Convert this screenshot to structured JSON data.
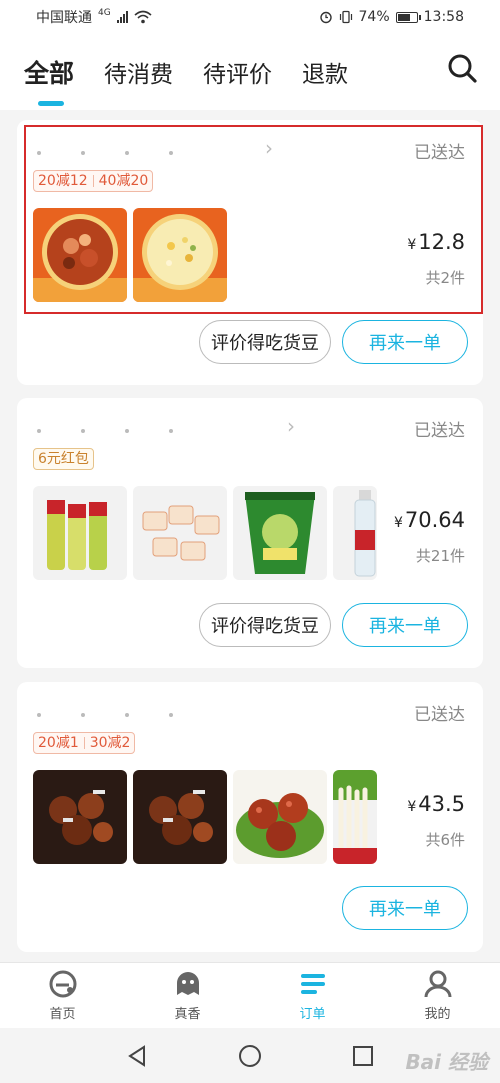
{
  "status_bar": {
    "carrier": "中国联通",
    "network": "4G",
    "battery": "74%",
    "battery_level": 0.74,
    "time": "13:58"
  },
  "tabs": [
    {
      "label": "全部",
      "active": true
    },
    {
      "label": "待消费",
      "active": false
    },
    {
      "label": "待评价",
      "active": false
    },
    {
      "label": "退款",
      "active": false
    }
  ],
  "orders": [
    {
      "status": "已送达",
      "promos": [
        "20减12",
        "40减20"
      ],
      "price": "12.8",
      "currency": "¥",
      "count": "共2件",
      "review_button": "评价得吃货豆",
      "reorder_button": "再来一单"
    },
    {
      "status": "已送达",
      "promos": [
        "6元红包"
      ],
      "price": "70.64",
      "currency": "¥",
      "count": "共21件",
      "review_button": "评价得吃货豆",
      "reorder_button": "再来一单"
    },
    {
      "status": "已送达",
      "promos": [
        "20减1",
        "30减2"
      ],
      "price": "43.5",
      "currency": "¥",
      "count": "共6件",
      "reorder_button": "再来一单"
    }
  ],
  "bottom_nav": [
    {
      "label": "首页",
      "icon": "eleme-home-icon",
      "active": false
    },
    {
      "label": "真香",
      "icon": "ghost-icon",
      "active": false
    },
    {
      "label": "订单",
      "icon": "list-icon",
      "active": true
    },
    {
      "label": "我的",
      "icon": "person-icon",
      "active": false
    }
  ],
  "watermark": "Bai 经验",
  "colors": {
    "accent": "#1bb4e0",
    "promo_red": "#e05a3a",
    "promo_gold": "#c9822d",
    "highlight": "#d62b2b"
  }
}
